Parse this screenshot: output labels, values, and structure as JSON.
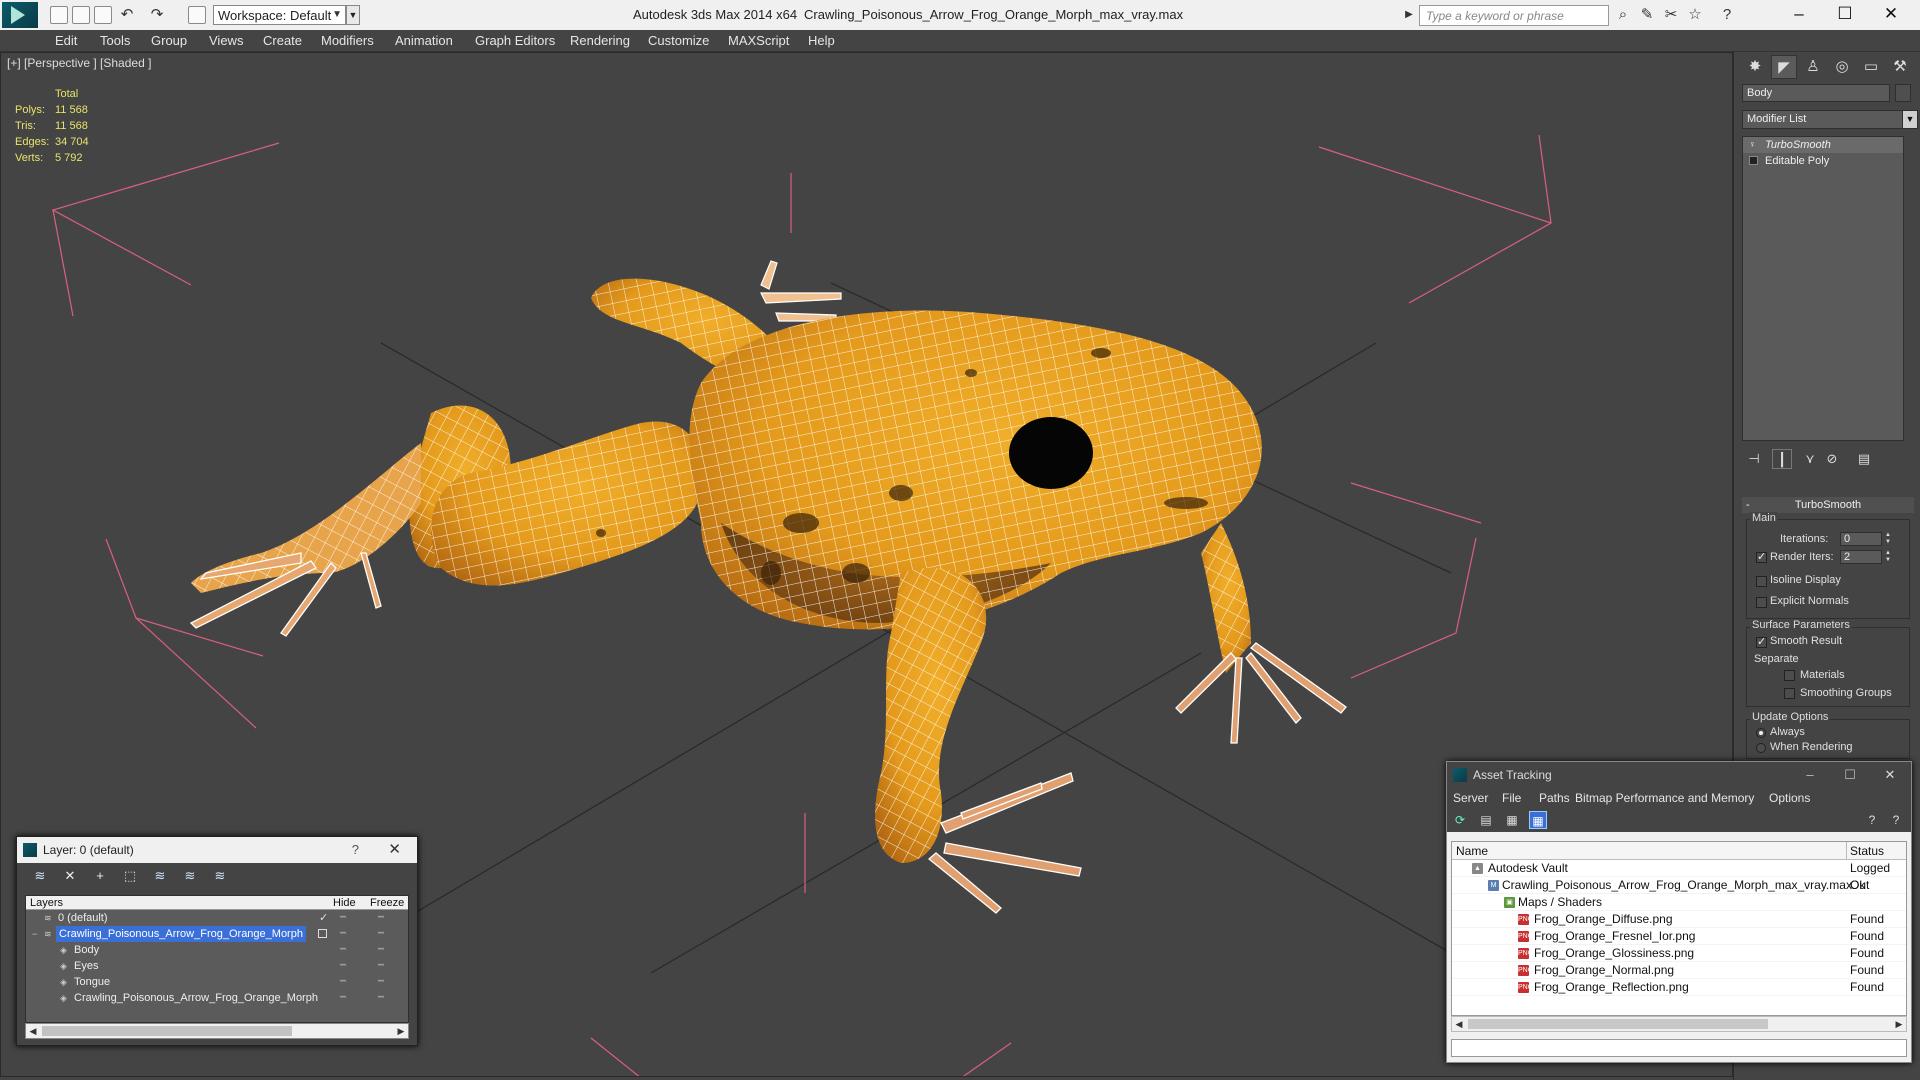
{
  "titlebar": {
    "workspace": "Workspace: Default",
    "app_title": "Autodesk 3ds Max  2014 x64",
    "doc_title": "Crawling_Poisonous_Arrow_Frog_Orange_Morph_max_vray.max",
    "search_placeholder": "Type a keyword or phrase"
  },
  "menu": [
    "Edit",
    "Tools",
    "Group",
    "Views",
    "Create",
    "Modifiers",
    "Animation",
    "Graph Editors",
    "Rendering",
    "Customize",
    "MAXScript",
    "Help"
  ],
  "viewport": {
    "label": "[+] [Perspective ] [Shaded ]",
    "stats": {
      "header": "Total",
      "rows": [
        {
          "label": "Polys:",
          "value": "11 568"
        },
        {
          "label": "Tris:",
          "value": "11 568"
        },
        {
          "label": "Edges:",
          "value": "34 704"
        },
        {
          "label": "Verts:",
          "value": "5 792"
        }
      ]
    }
  },
  "command_panel": {
    "object_name": "Body",
    "modifier_list": "Modifier List",
    "stack": [
      "TurboSmooth",
      "Editable Poly"
    ],
    "rollout_title": "TurboSmooth",
    "main_group": "Main",
    "iterations_label": "Iterations:",
    "iterations_value": "0",
    "render_iters_label": "Render Iters:",
    "render_iters_value": "2",
    "isoline_label": "Isoline Display",
    "explicit_normals_label": "Explicit Normals",
    "surface_group": "Surface Parameters",
    "smooth_result_label": "Smooth Result",
    "separate_label": "Separate",
    "materials_label": "Materials",
    "smoothing_groups_label": "Smoothing Groups",
    "update_group": "Update Options",
    "always_label": "Always",
    "when_rendering_label": "When Rendering"
  },
  "layer_window": {
    "title": "Layer: 0 (default)",
    "help": "?",
    "columns": {
      "layers": "Layers",
      "hide": "Hide",
      "freeze": "Freeze"
    },
    "rows": [
      {
        "name": "0 (default)",
        "indent": 1,
        "active": true
      },
      {
        "name": "Crawling_Poisonous_Arrow_Frog_Orange_Morph",
        "indent": 1,
        "selected": true
      },
      {
        "name": "Body",
        "indent": 2
      },
      {
        "name": "Eyes",
        "indent": 2
      },
      {
        "name": "Tongue",
        "indent": 2
      },
      {
        "name": "Crawling_Poisonous_Arrow_Frog_Orange_Morph",
        "indent": 2
      }
    ]
  },
  "asset_window": {
    "title": "Asset Tracking",
    "menu": [
      "Server",
      "File",
      "Paths",
      "Bitmap Performance and Memory",
      "Options"
    ],
    "columns": {
      "name": "Name",
      "status": "Status"
    },
    "rows": [
      {
        "name": "Autodesk Vault",
        "status": "Logged Out",
        "indent": 0,
        "icon": "vault"
      },
      {
        "name": "Crawling_Poisonous_Arrow_Frog_Orange_Morph_max_vray.max",
        "status": "Ok",
        "indent": 1,
        "icon": "file"
      },
      {
        "name": "Maps / Shaders",
        "status": "",
        "indent": 2,
        "icon": "folder"
      },
      {
        "name": "Frog_Orange_Diffuse.png",
        "status": "Found",
        "indent": 3,
        "icon": "png"
      },
      {
        "name": "Frog_Orange_Fresnel_Ior.png",
        "status": "Found",
        "indent": 3,
        "icon": "png"
      },
      {
        "name": "Frog_Orange_Glossiness.png",
        "status": "Found",
        "indent": 3,
        "icon": "png"
      },
      {
        "name": "Frog_Orange_Normal.png",
        "status": "Found",
        "indent": 3,
        "icon": "png"
      },
      {
        "name": "Frog_Orange_Reflection.png",
        "status": "Found",
        "indent": 3,
        "icon": "png"
      }
    ]
  },
  "colors": {
    "stats_text": "#e8e36a",
    "frog_body": "#e8a020",
    "selection": "#3a6fd8",
    "bounding_box": "#e06a8a"
  }
}
